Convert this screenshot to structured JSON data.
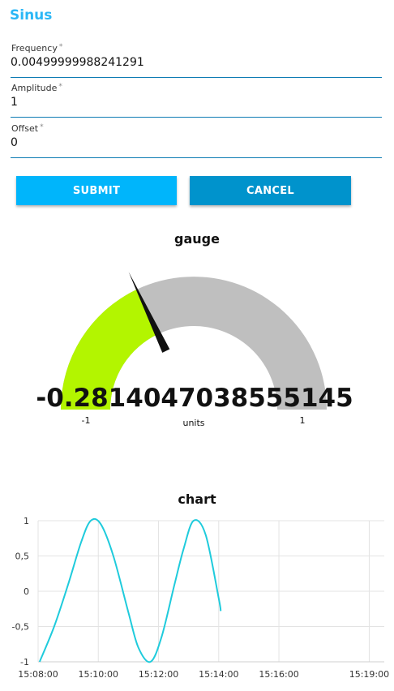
{
  "group": {
    "title": "Sinus"
  },
  "form": {
    "fields": [
      {
        "label": "Frequency",
        "required_mark": "*",
        "value": "0.00499999988241291"
      },
      {
        "label": "Amplitude",
        "required_mark": "*",
        "value": "1"
      },
      {
        "label": "Offset",
        "required_mark": "*",
        "value": "0"
      }
    ],
    "submit_label": "SUBMIT",
    "cancel_label": "CANCEL",
    "colors": {
      "submit": "#00b5fb",
      "cancel": "#0093cc",
      "accent": "#2ab7f6"
    }
  },
  "gauge": {
    "title": "gauge",
    "value": -0.2814047038555145,
    "value_text": "-0.2814047038555145",
    "min": -1,
    "max": 1,
    "min_label": "-1",
    "max_label": "1",
    "units": "units",
    "colors": {
      "fill": "#b3f500",
      "track": "#bfbfbf",
      "needle": "#111111"
    }
  },
  "chart_data": {
    "type": "line",
    "title": "chart",
    "xlabel": "",
    "ylabel": "",
    "ylim": [
      -1,
      1
    ],
    "yticks": [
      1,
      0.5,
      0,
      -0.5,
      -1
    ],
    "ytick_labels": [
      "1",
      "0,5",
      "0",
      "-0,5",
      "-1"
    ],
    "xticks": [
      "15:08:00",
      "15:10:00",
      "15:12:00",
      "15:14:00",
      "15:16:00",
      "15:19:00"
    ],
    "xlim": [
      "15:08:00",
      "15:19:30"
    ],
    "grid": true,
    "legend": "none",
    "series": [
      {
        "color": "#1fcbdc",
        "x": [
          "15:08:03",
          "15:08:32",
          "15:09:00",
          "15:09:26",
          "15:09:45",
          "15:10:05",
          "15:10:30",
          "15:11:00",
          "15:11:20",
          "15:11:44",
          "15:12:06",
          "15:12:32",
          "15:12:50",
          "15:13:10",
          "15:13:34",
          "15:14:00",
          "15:14:04"
        ],
        "values": [
          -1.0,
          -0.5,
          0.1,
          0.7,
          1.0,
          0.95,
          0.5,
          -0.3,
          -0.8,
          -1.0,
          -0.65,
          0.1,
          0.6,
          1.0,
          0.8,
          -0.1,
          -0.28
        ]
      }
    ]
  }
}
